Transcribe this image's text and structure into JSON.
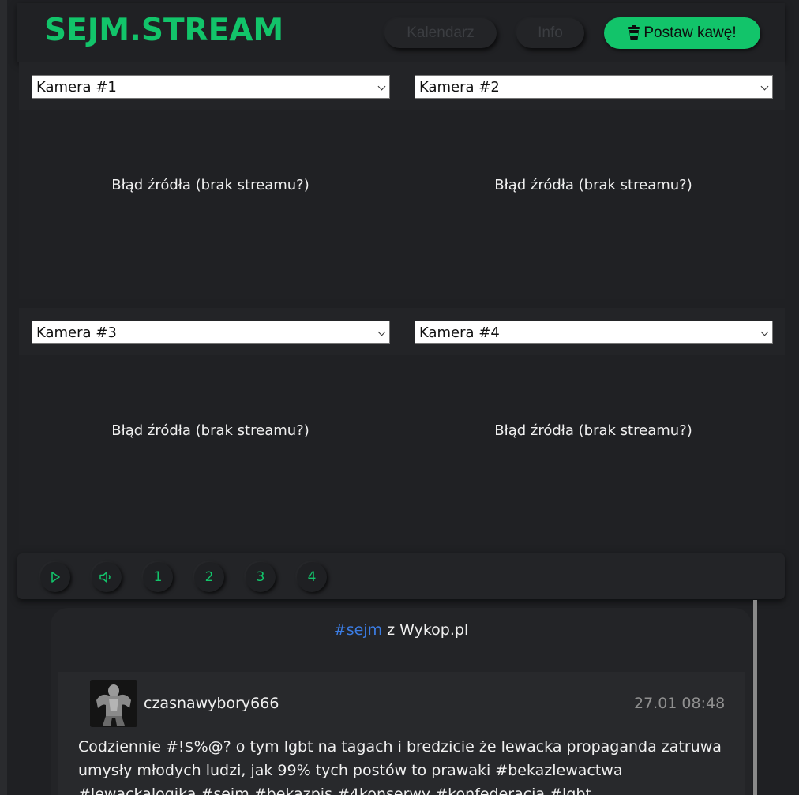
{
  "header": {
    "logo": "SEJM.STREAM",
    "nav": {
      "calendar_label": "Kalendarz",
      "info_label": "Info"
    },
    "coffee_label": "Postaw kawę!"
  },
  "cameras": [
    {
      "selected": "Kamera #1",
      "message": "Błąd źródła (brak streamu?)"
    },
    {
      "selected": "Kamera #2",
      "message": "Błąd źródła (brak streamu?)"
    },
    {
      "selected": "Kamera #3",
      "message": "Błąd źródła (brak streamu?)"
    },
    {
      "selected": "Kamera #4",
      "message": "Błąd źródła (brak streamu?)"
    }
  ],
  "controls": {
    "play_icon": "play-icon",
    "volume_icon": "volume-icon",
    "layouts": [
      "1",
      "2",
      "3",
      "4"
    ]
  },
  "feed": {
    "tag": "#sejm",
    "source_text": " z Wykop.pl",
    "post": {
      "username": "czasnawybory666",
      "timestamp": "27.01 08:48",
      "text": "Codziennie #!$%@? o tym lgbt na tagach i bredzicie że lewacka propaganda zatruwa umysły młodych ludzi, jak 99% tych postów to prawaki #bekazlewactwa #lewackalogika #sejm #bekazpis #4konserwy #konfederacja #lgbt"
    }
  },
  "colors": {
    "accent": "#12c46a",
    "background": "#1f2023",
    "panel": "#232427",
    "link": "#3b7ce3"
  }
}
